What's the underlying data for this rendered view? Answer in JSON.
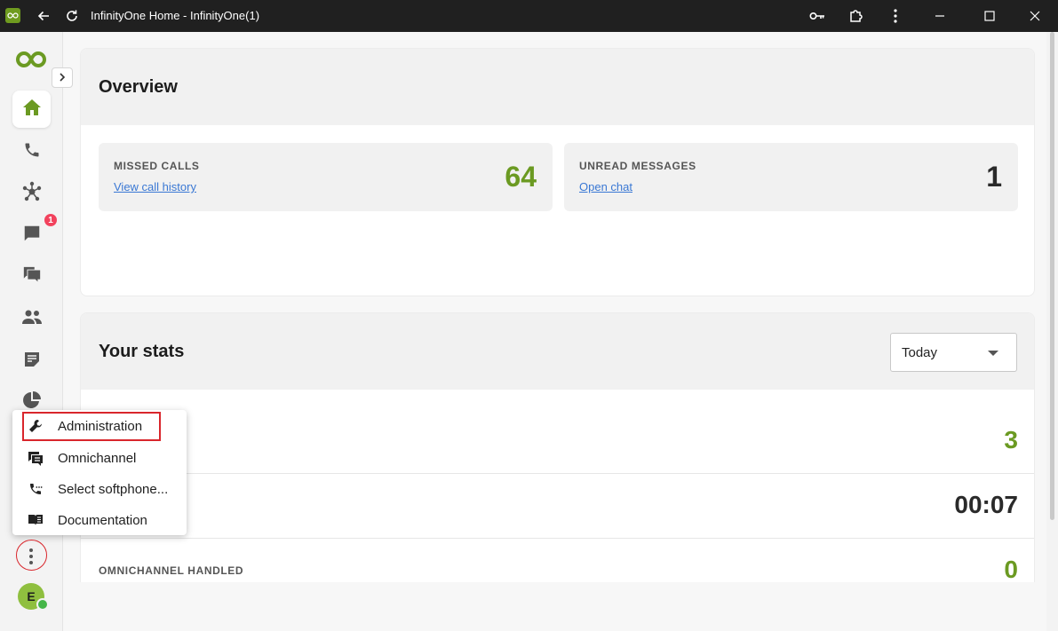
{
  "window": {
    "title": "InfinityOne Home - InfinityOne(1)",
    "app_icon": "infinity-logo",
    "controls": [
      "key-icon",
      "extension-icon",
      "more-vert-icon",
      "minimize-icon",
      "maximize-icon",
      "close-icon"
    ]
  },
  "sidebar": {
    "items": [
      {
        "icon": "home-icon",
        "active": true
      },
      {
        "icon": "phone-icon"
      },
      {
        "icon": "hub-icon"
      },
      {
        "icon": "chat-icon",
        "badge": "1"
      },
      {
        "icon": "forum-icon"
      },
      {
        "icon": "people-icon"
      },
      {
        "icon": "notes-icon"
      },
      {
        "icon": "pie-chart-icon"
      }
    ],
    "avatar_initial": "E"
  },
  "overview": {
    "title": "Overview",
    "cards": [
      {
        "label": "MISSED CALLS",
        "link": "View call history",
        "value": "64"
      },
      {
        "label": "UNREAD MESSAGES",
        "link": "Open chat",
        "value": "1"
      }
    ]
  },
  "stats": {
    "title": "Your stats",
    "period": "Today",
    "rows": [
      {
        "label": "",
        "value": "3"
      },
      {
        "label": "",
        "value": "00:07"
      },
      {
        "label": "OMNICHANNEL HANDLED",
        "value": "0"
      }
    ]
  },
  "menu": {
    "items": [
      {
        "label": "Administration",
        "icon": "wrench-icon"
      },
      {
        "label": "Omnichannel",
        "icon": "omnichannel-icon"
      },
      {
        "label": "Select softphone...",
        "icon": "phone-settings-icon"
      },
      {
        "label": "Documentation",
        "icon": "book-icon"
      }
    ]
  },
  "colors": {
    "accent_green": "#6b9a22",
    "badge_red": "#f2425d",
    "link_blue": "#3a78d4",
    "highlight_red": "#d9262c"
  }
}
